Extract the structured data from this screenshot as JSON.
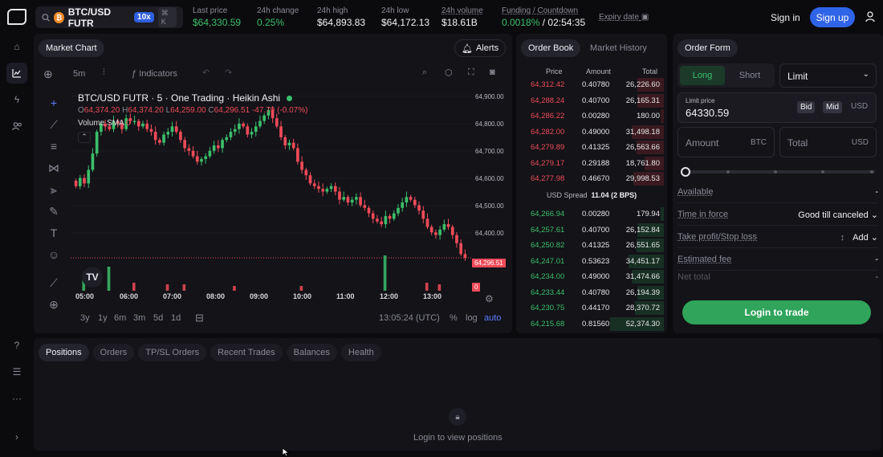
{
  "topbar": {
    "market": "BTC/USD FUTR",
    "leverage": "10x",
    "shortcut": "⌘ K",
    "stats": [
      {
        "label": "Last price",
        "value": "$64,330.59",
        "color": "green"
      },
      {
        "label": "24h change",
        "value": "0.25%",
        "color": "green"
      },
      {
        "label": "24h high",
        "value": "$64,893.83",
        "color": ""
      },
      {
        "label": "24h low",
        "value": "$64,172.13",
        "color": ""
      },
      {
        "label": "24h volume",
        "value": "$18.61B",
        "color": ""
      }
    ],
    "funding_label": "Funding / Countdown",
    "funding_rate": "0.0018%",
    "funding_sep": "/",
    "countdown": "02:54:35",
    "expiry_label": "Expiry date",
    "signin": "Sign in",
    "signup": "Sign up"
  },
  "chart_panel": {
    "tab": "Market Chart",
    "alerts": "Alerts",
    "interval": "5m",
    "indicators": "Indicators",
    "title": "BTC/USD FUTR · 5 · One Trading · Heikin Ashi",
    "ohlc": {
      "o_label": "O",
      "o": "64,374.20",
      "h_label": "H",
      "h": "64,374.20",
      "l_label": "L",
      "l": "64,259.00",
      "c_label": "C",
      "c": "64,296.51",
      "chg": "-47.79 (-0.07%)"
    },
    "volume_label": "Volume SMA",
    "volume_value": "0",
    "last_price_tag": "64,296.51",
    "volume_tag": "0",
    "ranges": [
      "3y",
      "1y",
      "6m",
      "3m",
      "5d",
      "1d"
    ],
    "clock": "13:05:24 (UTC)",
    "pct": "%",
    "log": "log",
    "auto": "auto"
  },
  "chart_data": {
    "type": "candlestick",
    "price_ticks": [
      "64,900.00",
      "64,800.00",
      "64,700.00",
      "64,600.00",
      "64,500.00",
      "64,400.00"
    ],
    "time_ticks": [
      "05:00",
      "06:00",
      "07:00",
      "08:00",
      "09:00",
      "10:00",
      "11:00",
      "12:00",
      "13:00"
    ],
    "ylim": [
      64240,
      64920
    ],
    "closes": [
      64560,
      64590,
      64570,
      64620,
      64680,
      64760,
      64790,
      64780,
      64770,
      64800,
      64790,
      64770,
      64810,
      64800,
      64800,
      64780,
      64790,
      64770,
      64760,
      64730,
      64720,
      64750,
      64760,
      64780,
      64760,
      64730,
      64700,
      64690,
      64670,
      64650,
      64660,
      64670,
      64690,
      64710,
      64700,
      64730,
      64740,
      64760,
      64770,
      64790,
      64780,
      64750,
      64760,
      64780,
      64800,
      64820,
      64840,
      64810,
      64780,
      64740,
      64710,
      64720,
      64700,
      64650,
      64620,
      64600,
      64570,
      64560,
      64550,
      64540,
      64550,
      64560,
      64540,
      64510,
      64520,
      64500,
      64510,
      64520,
      64490,
      64480,
      64460,
      64440,
      64430,
      64420,
      64450,
      64440,
      64460,
      64480,
      64500,
      64520,
      64510,
      64490,
      64470,
      64440,
      64410,
      64390,
      64380,
      64400,
      64420,
      64410,
      64380,
      64350,
      64310,
      64296
    ]
  },
  "order_book": {
    "tab_active": "Order Book",
    "tab_other": "Market History",
    "headers": [
      "Price",
      "Amount",
      "Total"
    ],
    "asks": [
      [
        "64,312.42",
        "0.40780",
        "26,226.60"
      ],
      [
        "64,288.24",
        "0.40700",
        "26,165.31"
      ],
      [
        "64,286.22",
        "0.00280",
        "180.00"
      ],
      [
        "64,282.00",
        "0.49000",
        "31,498.18"
      ],
      [
        "64,279.89",
        "0.41325",
        "26,563.66"
      ],
      [
        "64,279.17",
        "0.29188",
        "18,761.80"
      ],
      [
        "64,277.98",
        "0.46670",
        "29,998.53"
      ]
    ],
    "spread_label": "USD Spread",
    "spread_value": "11.04 (2 BPS)",
    "bids": [
      [
        "64,266.94",
        "0.00280",
        "179.94"
      ],
      [
        "64,257.61",
        "0.40700",
        "26,152.84"
      ],
      [
        "64,250.82",
        "0.41325",
        "26,551.65"
      ],
      [
        "64,247.01",
        "0.53623",
        "34,451.17"
      ],
      [
        "64,234.00",
        "0.49000",
        "31,474.66"
      ],
      [
        "64,233.44",
        "0.40780",
        "26,194.39"
      ],
      [
        "64,230.75",
        "0.44170",
        "28,370.72"
      ],
      [
        "64,215.68",
        "0.81560",
        "52,374.30"
      ]
    ]
  },
  "order_form": {
    "tab": "Order Form",
    "long": "Long",
    "short": "Short",
    "type": "Limit",
    "limit_label": "Limit price",
    "limit_value": "64330.59",
    "bid": "Bid",
    "mid": "Mid",
    "usd": "USD",
    "amount": "Amount",
    "btc": "BTC",
    "total": "Total",
    "total_unit": "USD",
    "rows": [
      {
        "k": "Available",
        "v": "-"
      },
      {
        "k": "Time in force",
        "v": "Good till canceled"
      },
      {
        "k": "Take profit/Stop loss",
        "v": "Add"
      },
      {
        "k": "Estimated fee",
        "v": "-"
      },
      {
        "k": "Net total",
        "v": "-"
      }
    ],
    "login": "Login to trade"
  },
  "bottom": {
    "tabs": [
      "Positions",
      "Orders",
      "TP/SL Orders",
      "Recent Trades",
      "Balances",
      "Health"
    ],
    "empty_text": "Login to view positions"
  }
}
